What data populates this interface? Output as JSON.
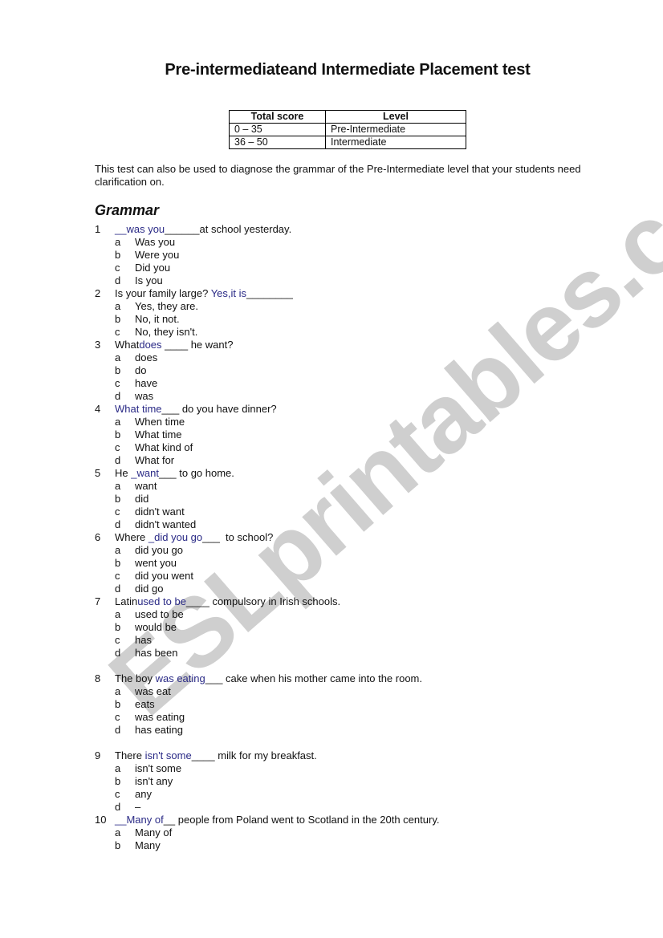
{
  "title": "Pre-intermediateand Intermediate Placement test",
  "watermark": "ESLprintables.com",
  "colors": {
    "answer_text": "#2a2a86",
    "watermark": "#cfcfcf"
  },
  "score_table": {
    "headers": [
      "Total score",
      "Level"
    ],
    "rows": [
      [
        "0 – 35",
        "Pre-Intermediate"
      ],
      [
        "36 – 50",
        "Intermediate"
      ]
    ]
  },
  "intro": "This test can also be used to diagnose the grammar of the Pre-Intermediate level that your students need clarification on.",
  "section_title": "Grammar",
  "questions": [
    {
      "number": "1",
      "before": "",
      "answer": "__was you",
      "after": "______at school yesterday.",
      "options": [
        [
          "a",
          "Was you"
        ],
        [
          "b",
          "Were you"
        ],
        [
          "c",
          "Did you"
        ],
        [
          "d",
          "Is you"
        ]
      ]
    },
    {
      "number": "2",
      "before": "Is your family large? ",
      "answer": "Yes,it is",
      "after": "________",
      "options": [
        [
          "a",
          "Yes, they are."
        ],
        [
          "b",
          "No, it not."
        ],
        [
          "c",
          "No, they isn't."
        ]
      ]
    },
    {
      "number": "3",
      "before": "What",
      "answer": "does",
      "after": " ____ he want?",
      "options": [
        [
          "a",
          "does"
        ],
        [
          "b",
          "do"
        ],
        [
          "c",
          "have"
        ],
        [
          "d",
          "was"
        ]
      ]
    },
    {
      "number": "4",
      "before": "",
      "answer": "What time",
      "after": "___ do you have dinner?",
      "options": [
        [
          "a",
          "When time"
        ],
        [
          "b",
          "What time"
        ],
        [
          "c",
          "What kind of"
        ],
        [
          "d",
          "What for"
        ]
      ]
    },
    {
      "number": "5",
      "before": "He ",
      "answer": "_want",
      "after": "___ to go home.",
      "options": [
        [
          "a",
          "want"
        ],
        [
          "b",
          "did"
        ],
        [
          "c",
          "didn't want"
        ],
        [
          "d",
          "didn't wanted"
        ]
      ]
    },
    {
      "number": "6",
      "before": "Where ",
      "answer": "_did you go",
      "after": "___  to school?",
      "options": [
        [
          "a",
          "did you go"
        ],
        [
          "b",
          "went you"
        ],
        [
          "c",
          "did you went"
        ],
        [
          "d",
          "did go"
        ]
      ]
    },
    {
      "number": "7",
      "before": "Latin",
      "answer": "used to be",
      "after": "____ compulsory in Irish schools.",
      "options": [
        [
          "a",
          "used to be"
        ],
        [
          "b",
          "would be"
        ],
        [
          "c",
          "has"
        ],
        [
          "d",
          "has been"
        ]
      ]
    },
    {
      "number": "8",
      "before": "The boy ",
      "answer": "was eating",
      "after": "___ cake when his mother came into the room.",
      "options": [
        [
          "a",
          "was eat"
        ],
        [
          "b",
          "eats"
        ],
        [
          "c",
          "was eating"
        ],
        [
          "d",
          "has eating"
        ]
      ]
    },
    {
      "number": "9",
      "before": "There ",
      "answer": "isn't some",
      "after": "____ milk for my breakfast.",
      "options": [
        [
          "a",
          "isn't some"
        ],
        [
          "b",
          "isn't any"
        ],
        [
          "c",
          "any"
        ],
        [
          "d",
          "–"
        ]
      ]
    },
    {
      "number": "10",
      "before": "",
      "answer": "__Many of",
      "after": "__ people from Poland went to Scotland in the 20th century.",
      "options": [
        [
          "a",
          "Many of"
        ],
        [
          "b",
          "Many"
        ]
      ]
    }
  ]
}
